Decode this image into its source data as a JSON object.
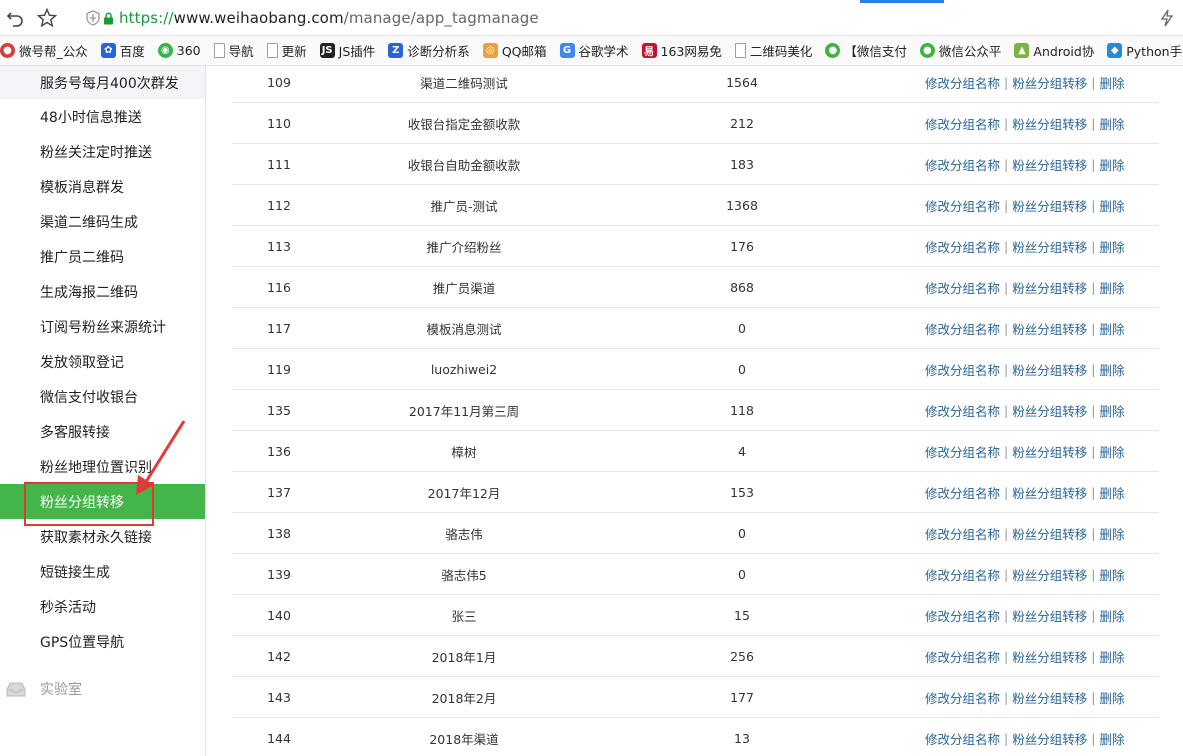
{
  "browser": {
    "url_scheme": "https://",
    "url_host": "www.weihaobang.com",
    "url_path": "/manage/app_tagmanage"
  },
  "bookmarks": [
    {
      "label": "微号帮_公众",
      "icon": "wechat-icon",
      "color": "#d33f3f"
    },
    {
      "label": "百度",
      "icon": "baidu-paw-icon",
      "color": "#2b62d8"
    },
    {
      "label": "360",
      "icon": "360-icon",
      "color": "#36b44a"
    },
    {
      "label": "导航",
      "icon": "page-icon",
      "color": "#9e9e9e"
    },
    {
      "label": "更新",
      "icon": "page-icon",
      "color": "#9e9e9e"
    },
    {
      "label": "JS插件",
      "icon": "js-icon",
      "color": "#222222"
    },
    {
      "label": "诊断分析系",
      "icon": "chart-icon",
      "color": "#2b62d8"
    },
    {
      "label": "QQ邮箱",
      "icon": "chrome-icon",
      "color": "#e8a33d"
    },
    {
      "label": "谷歌学术",
      "icon": "google-icon",
      "color": "#4285f4"
    },
    {
      "label": "163网易免",
      "icon": "163-icon",
      "color": "#c8102e"
    },
    {
      "label": "二维码美化",
      "icon": "page-icon",
      "color": "#9e9e9e"
    },
    {
      "label": "【微信支付",
      "icon": "wechat-icon",
      "color": "#3fb33f"
    },
    {
      "label": "微信公众平",
      "icon": "wechat-icon",
      "color": "#3fb33f"
    },
    {
      "label": "Android协",
      "icon": "android-icon",
      "color": "#7cb342"
    },
    {
      "label": "Python手册",
      "icon": "python-icon",
      "color": "#2b8ad8"
    }
  ],
  "sidebar": {
    "items": [
      {
        "label": "服务号每月400次群发"
      },
      {
        "label": "48小时信息推送"
      },
      {
        "label": "粉丝关注定时推送"
      },
      {
        "label": "模板消息群发"
      },
      {
        "label": "渠道二维码生成"
      },
      {
        "label": "推广员二维码"
      },
      {
        "label": "生成海报二维码"
      },
      {
        "label": "订阅号粉丝来源统计"
      },
      {
        "label": "发放领取登记"
      },
      {
        "label": "微信支付收银台"
      },
      {
        "label": "多客服转接"
      },
      {
        "label": "粉丝地理位置识别"
      },
      {
        "label": "粉丝分组转移"
      },
      {
        "label": "获取素材永久链接"
      },
      {
        "label": "短链接生成"
      },
      {
        "label": "秒杀活动"
      },
      {
        "label": "GPS位置导航"
      }
    ],
    "section_label": "实验室",
    "active_color": "#44b549"
  },
  "table": {
    "ops": {
      "rename": "修改分组名称",
      "transfer": "粉丝分组转移",
      "delete": "删除",
      "separator": "|"
    },
    "link_color": "#2a6496",
    "rows": [
      {
        "id": "109",
        "name": "渠道二维码测试",
        "count": "1564"
      },
      {
        "id": "110",
        "name": "收银台指定金额收款",
        "count": "212"
      },
      {
        "id": "111",
        "name": "收银台自助金额收款",
        "count": "183"
      },
      {
        "id": "112",
        "name": "推广员-测试",
        "count": "1368"
      },
      {
        "id": "113",
        "name": "推广介绍粉丝",
        "count": "176"
      },
      {
        "id": "116",
        "name": "推广员渠道",
        "count": "868"
      },
      {
        "id": "117",
        "name": "模板消息测试",
        "count": "0"
      },
      {
        "id": "119",
        "name": "luozhiwei2",
        "count": "0"
      },
      {
        "id": "135",
        "name": "2017年11月第三周",
        "count": "118"
      },
      {
        "id": "136",
        "name": "樟树",
        "count": "4"
      },
      {
        "id": "137",
        "name": "2017年12月",
        "count": "153"
      },
      {
        "id": "138",
        "name": "骆志伟",
        "count": "0"
      },
      {
        "id": "139",
        "name": "骆志伟5",
        "count": "0"
      },
      {
        "id": "140",
        "name": "张三",
        "count": "15"
      },
      {
        "id": "142",
        "name": "2018年1月",
        "count": "256"
      },
      {
        "id": "143",
        "name": "2018年2月",
        "count": "177"
      },
      {
        "id": "144",
        "name": "2018年渠道",
        "count": "13"
      }
    ]
  }
}
